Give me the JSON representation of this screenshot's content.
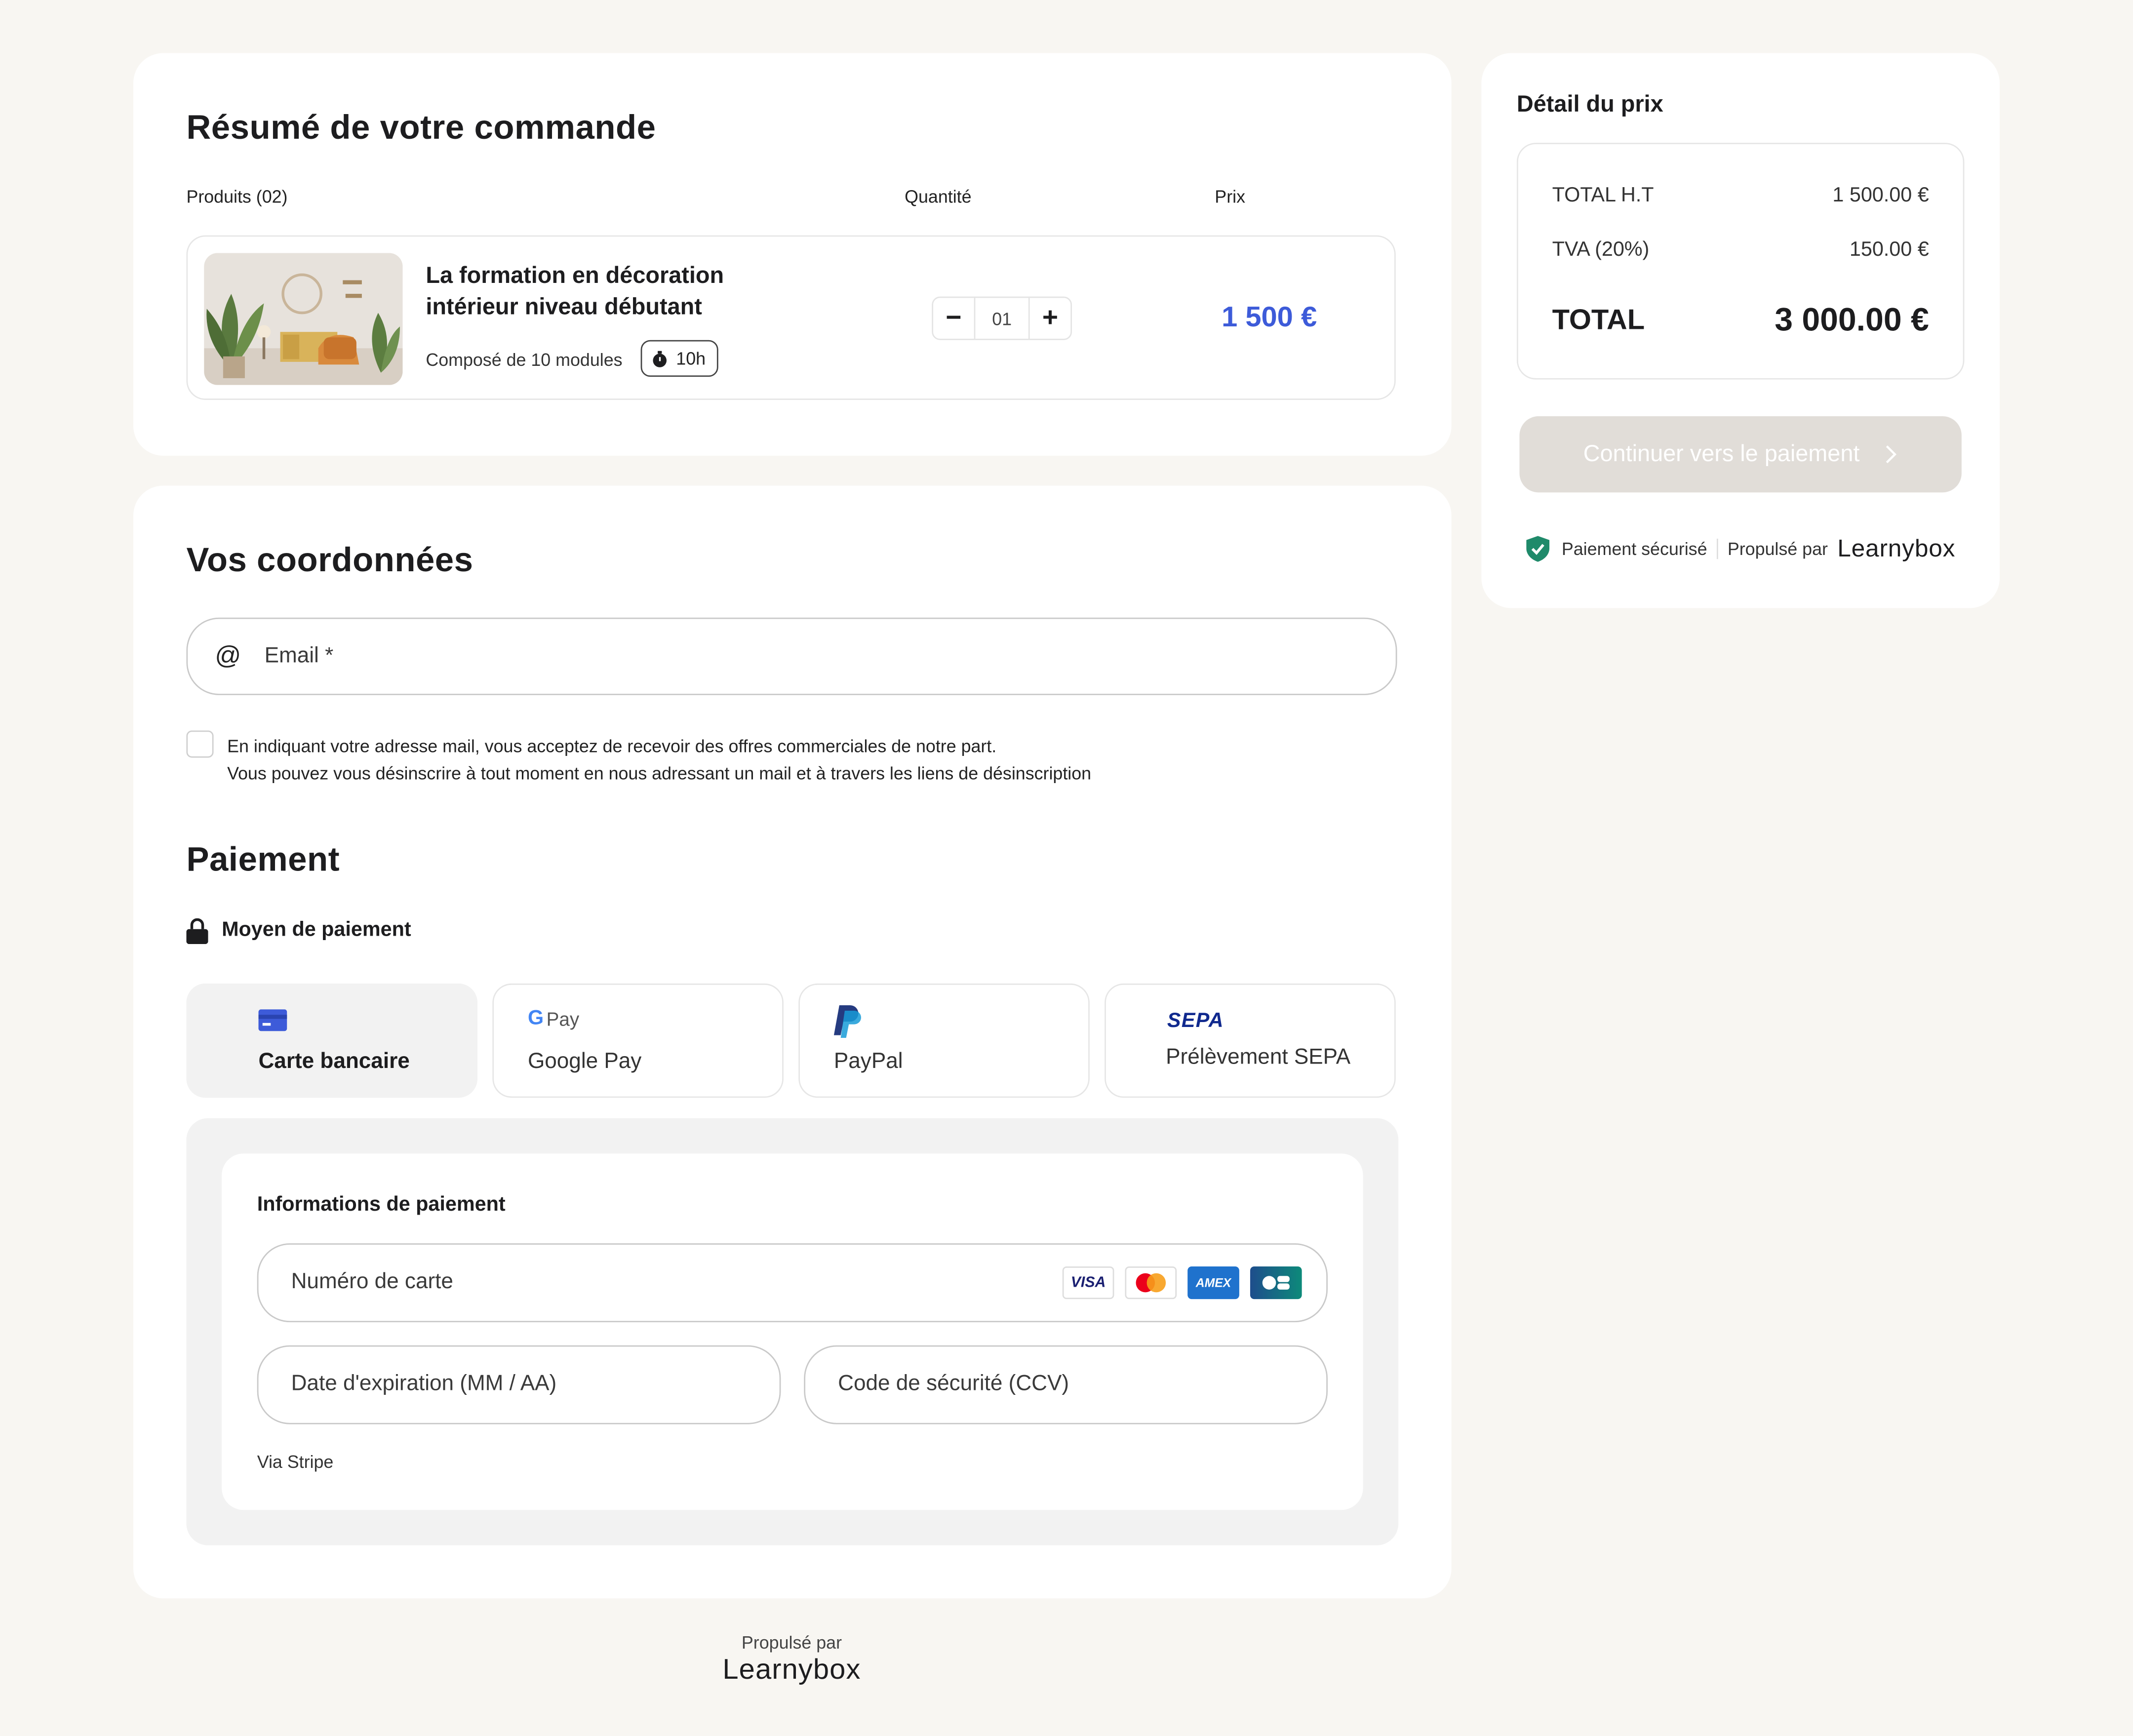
{
  "order": {
    "title": "Résumé de votre commande",
    "col_products": "Produits (02)",
    "col_quantity": "Quantité",
    "col_price": "Prix",
    "product": {
      "name_line1": "La formation en décoration",
      "name_line2": "intérieur niveau débutant",
      "modules": "Composé de 10 modules",
      "duration": "10h",
      "quantity": "01",
      "price": "1 500 €"
    }
  },
  "contact": {
    "title": "Vos coordonnées",
    "email_placeholder": "Email *",
    "consent_line1": "En indiquant votre adresse mail, vous acceptez de recevoir des offres commerciales de notre part.",
    "consent_line2": "Vous pouvez vous désinscrire à tout moment en nous adressant un mail et à travers les liens de désinscription"
  },
  "payment": {
    "title": "Paiement",
    "method_heading": "Moyen de paiement",
    "methods": [
      {
        "label": "Carte bancaire",
        "icon": "credit-card-icon",
        "active": true
      },
      {
        "label": "Google Pay",
        "logo": "Pay",
        "icon": "google-pay-logo"
      },
      {
        "label": "PayPal",
        "icon": "paypal-icon"
      },
      {
        "label": "Prélèvement SEPA",
        "logo": "SEPA",
        "icon": "sepa-logo"
      }
    ],
    "info_title": "Informations de paiement",
    "card_number_placeholder": "Numéro de carte",
    "expiry_placeholder": "Date d'expiration (MM / AA)",
    "cvc_placeholder": "Code de sécurité (CCV)",
    "via": "Via Stripe",
    "card_brands": {
      "visa": "VISA",
      "amex": "AMEX"
    }
  },
  "price_detail": {
    "title": "Détail du prix",
    "subtotal_label": "TOTAL H.T",
    "subtotal_value": "1 500.00 €",
    "vat_label": "TVA (20%)",
    "vat_value": "150.00 €",
    "total_label": "TOTAL",
    "total_value": "3 000.00 €",
    "cta": "Continuer vers le paiement",
    "secure": "Paiement sécurisé",
    "powered": "Propulsé par",
    "brand": "Learnybox"
  },
  "footer": {
    "powered": "Propulsé par",
    "brand": "Learnybox"
  },
  "colors": {
    "background": "#f8f6f2",
    "accent_blue": "#3d5bd9",
    "cta_disabled": "#e1ddd8",
    "secure_green": "#1f8a6a"
  }
}
